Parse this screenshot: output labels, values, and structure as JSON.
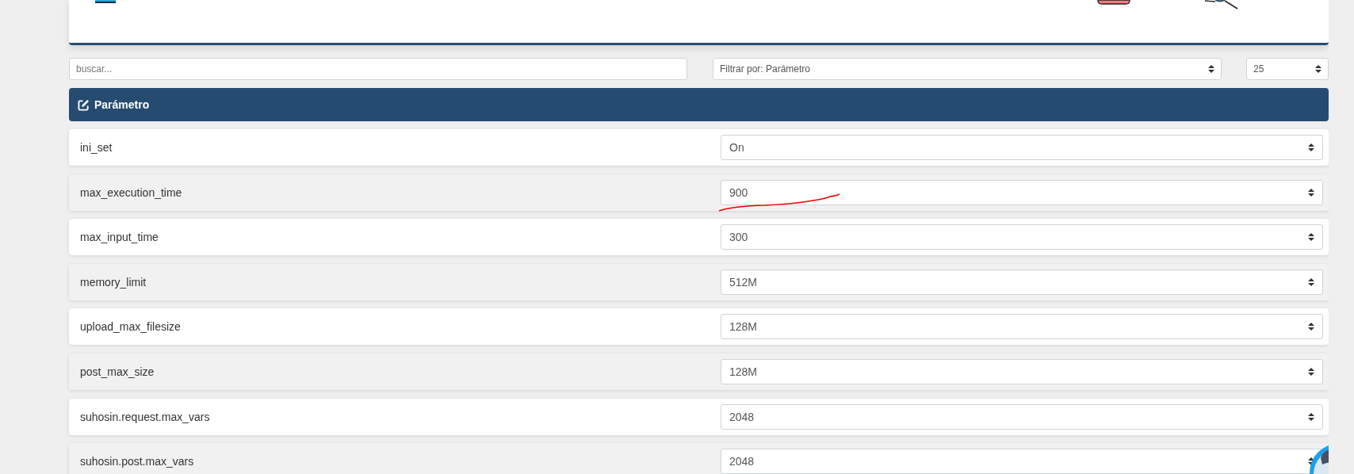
{
  "search": {
    "placeholder": "buscar..."
  },
  "filter": {
    "value": "Filtrar por: Parámetro"
  },
  "page_size": {
    "value": "25"
  },
  "panel": {
    "title": "Parámetro"
  },
  "params": [
    {
      "name": "ini_set",
      "value": "On"
    },
    {
      "name": "max_execution_time",
      "value": "900"
    },
    {
      "name": "max_input_time",
      "value": "300"
    },
    {
      "name": "memory_limit",
      "value": "512M"
    },
    {
      "name": "upload_max_filesize",
      "value": "128M"
    },
    {
      "name": "post_max_size",
      "value": "128M"
    },
    {
      "name": "suhosin.request.max_vars",
      "value": "2048"
    },
    {
      "name": "suhosin.post.max_vars",
      "value": "2048"
    }
  ]
}
